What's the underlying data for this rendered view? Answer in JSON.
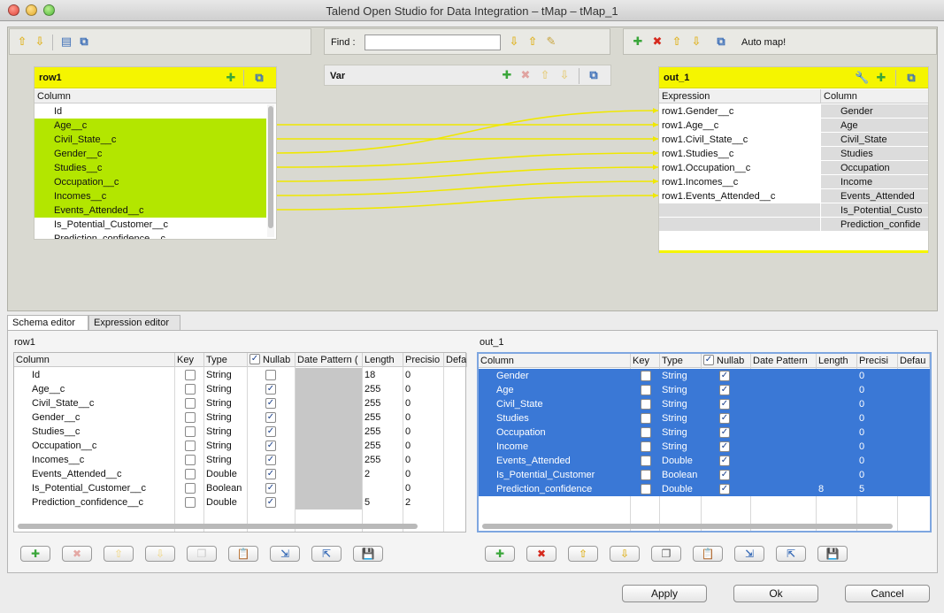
{
  "window": {
    "title": "Talend Open Studio for Data Integration – tMap – tMap_1"
  },
  "find": {
    "label": "Find :",
    "value": ""
  },
  "automap": {
    "label": "Auto map!"
  },
  "input_table": {
    "title": "row1",
    "column_header": "Column",
    "rows": [
      "Id",
      "Age__c",
      "Civil_State__c",
      "Gender__c",
      "Studies__c",
      "Occupation__c",
      "Incomes__c",
      "Events_Attended__c",
      "Is_Potential_Customer__c",
      "Prediction_confidence__c"
    ]
  },
  "var_table": {
    "title": "Var"
  },
  "output_table": {
    "title": "out_1",
    "headers": [
      "Expression",
      "Column"
    ],
    "rows": [
      [
        "row1.Gender__c",
        "Gender"
      ],
      [
        "row1.Age__c",
        "Age"
      ],
      [
        "row1.Civil_State__c",
        "Civil_State"
      ],
      [
        "row1.Studies__c",
        "Studies"
      ],
      [
        "row1.Occupation__c",
        "Occupation"
      ],
      [
        "row1.Incomes__c",
        "Income"
      ],
      [
        "row1.Events_Attended__c",
        "Events_Attended"
      ],
      [
        "",
        "Is_Potential_Custo"
      ],
      [
        "",
        "Prediction_confide"
      ]
    ]
  },
  "tabs": [
    "Schema editor",
    "Expression editor"
  ],
  "schema_left": {
    "title": "row1",
    "headers": [
      "Column",
      "Key",
      "Type",
      "Nullab",
      "Date Pattern (",
      "Length",
      "Precisio",
      "Defa"
    ],
    "rows": [
      [
        "Id",
        false,
        "String",
        false,
        "",
        "18",
        "0"
      ],
      [
        "Age__c",
        false,
        "String",
        true,
        "",
        "255",
        "0"
      ],
      [
        "Civil_State__c",
        false,
        "String",
        true,
        "",
        "255",
        "0"
      ],
      [
        "Gender__c",
        false,
        "String",
        true,
        "",
        "255",
        "0"
      ],
      [
        "Studies__c",
        false,
        "String",
        true,
        "",
        "255",
        "0"
      ],
      [
        "Occupation__c",
        false,
        "String",
        true,
        "",
        "255",
        "0"
      ],
      [
        "Incomes__c",
        false,
        "String",
        true,
        "",
        "255",
        "0"
      ],
      [
        "Events_Attended__c",
        false,
        "Double",
        true,
        "",
        "2",
        "0"
      ],
      [
        "Is_Potential_Customer__c",
        false,
        "Boolean",
        true,
        "",
        "",
        "0"
      ],
      [
        "Prediction_confidence__c",
        false,
        "Double",
        true,
        "",
        "5",
        "2"
      ]
    ]
  },
  "schema_right": {
    "title": "out_1",
    "headers": [
      "Column",
      "Key",
      "Type",
      "Nullab",
      "Date Pattern",
      "Length",
      "Precisi",
      "Defau"
    ],
    "rows": [
      [
        "Gender",
        false,
        "String",
        true,
        "",
        "",
        "0"
      ],
      [
        "Age",
        false,
        "String",
        true,
        "",
        "",
        "0"
      ],
      [
        "Civil_State",
        false,
        "String",
        true,
        "",
        "",
        "0"
      ],
      [
        "Studies",
        false,
        "String",
        true,
        "",
        "",
        "0"
      ],
      [
        "Occupation",
        false,
        "String",
        true,
        "",
        "",
        "0"
      ],
      [
        "Income",
        false,
        "String",
        true,
        "",
        "",
        "0"
      ],
      [
        "Events_Attended",
        false,
        "Double",
        true,
        "",
        "",
        "0"
      ],
      [
        "Is_Potential_Customer",
        false,
        "Boolean",
        true,
        "",
        "",
        "0"
      ],
      [
        "Prediction_confidence",
        false,
        "Double",
        true,
        "",
        "8",
        "5"
      ]
    ]
  },
  "buttons": {
    "apply": "Apply",
    "ok": "Ok",
    "cancel": "Cancel"
  },
  "colors": {
    "selected_row": "#b3e600",
    "header_yellow": "#f5f500",
    "link_line": "#f0e800",
    "blue_select": "#3a78d6"
  }
}
